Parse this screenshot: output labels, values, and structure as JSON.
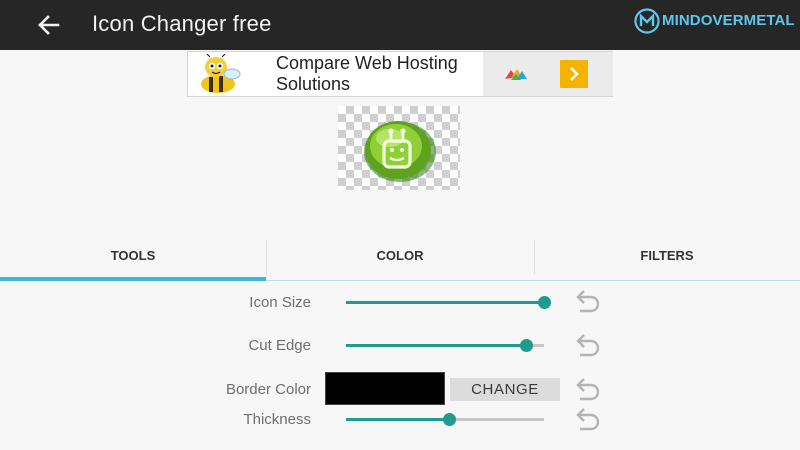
{
  "toolbar": {
    "title": "Icon Changer free",
    "back_icon": "arrow-left-icon",
    "background": "#262626"
  },
  "watermark": {
    "text": "MINDOVERMETAL",
    "color": "#5fc6ec"
  },
  "ad": {
    "headline": "Compare Web Hosting Solutions",
    "mascot_icon": "bee-mascot-icon",
    "adchoices_icon": "adchoices-icon",
    "go_icon": "chevron-right-icon",
    "go_color": "#f5b300"
  },
  "preview": {
    "icon": "green-android-app-icon",
    "background": "transparency-checkerboard"
  },
  "tabs": [
    {
      "label": "TOOLS",
      "selected": true
    },
    {
      "label": "COLOR",
      "selected": false
    },
    {
      "label": "FILTERS",
      "selected": false
    }
  ],
  "accent_color": "#3cb7dc",
  "slider_color": "#1e9c8c",
  "tools": {
    "icon_size": {
      "label": "Icon Size",
      "value_fraction": 1.0
    },
    "cut_edge": {
      "label": "Cut Edge",
      "value_fraction": 0.91
    },
    "border_color": {
      "label": "Border Color",
      "value": "#000000",
      "button_label": "CHANGE"
    },
    "thickness": {
      "label": "Thickness",
      "value_fraction": 0.52
    },
    "reset_icon": "undo-icon"
  }
}
